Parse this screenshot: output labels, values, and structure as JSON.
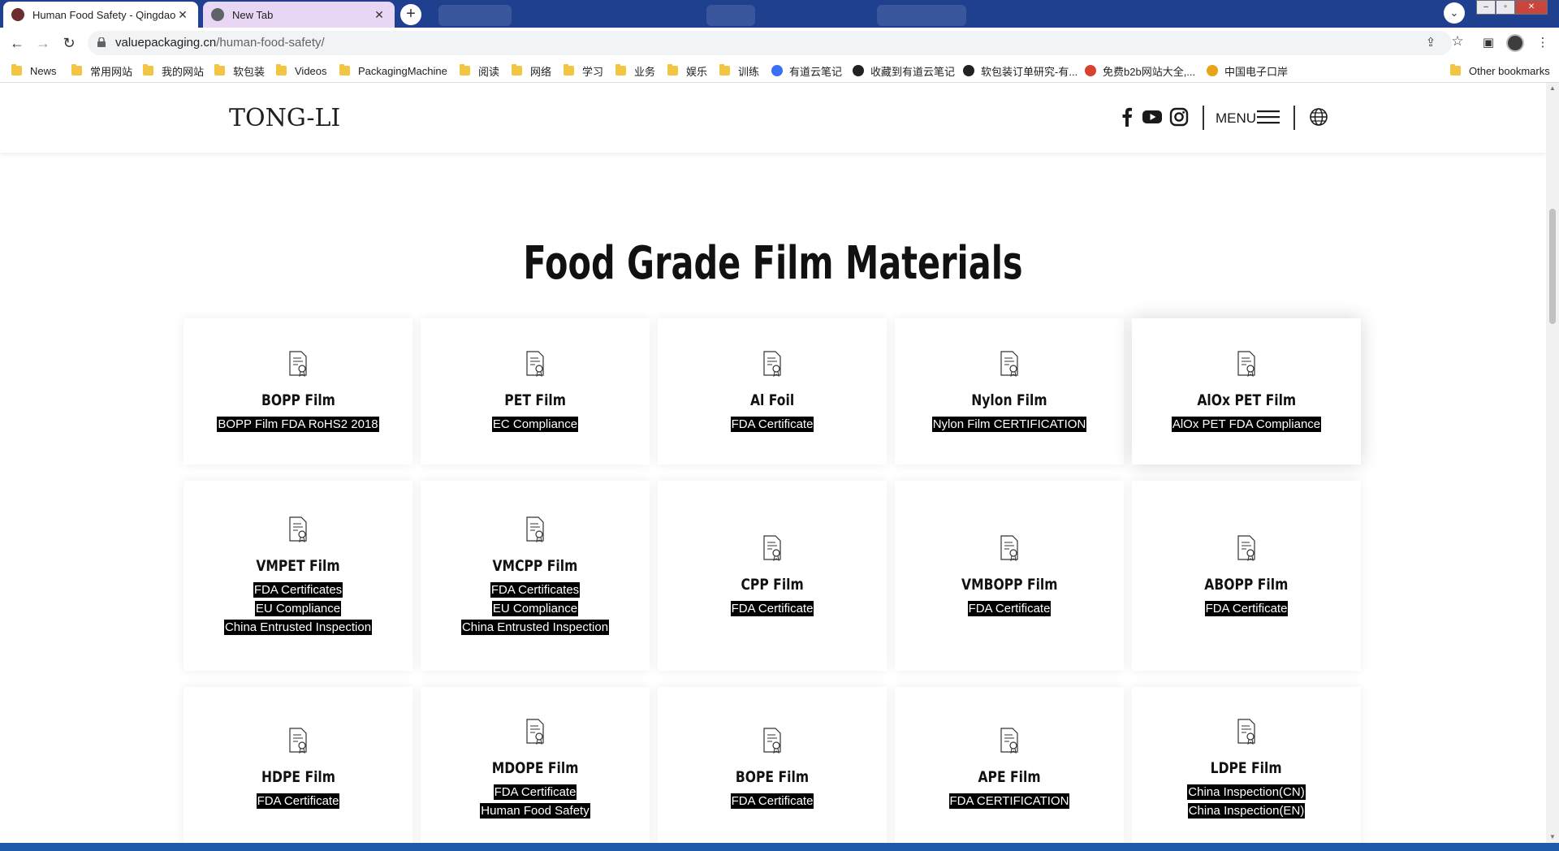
{
  "browser": {
    "tabs": [
      {
        "title": "Human Food Safety - Qingdao",
        "active": true
      },
      {
        "title": "New Tab",
        "active": false
      }
    ],
    "url_host": "valuepackaging.cn",
    "url_path": "/human-food-safety/",
    "bookmarks": [
      {
        "label": "News",
        "type": "folder"
      },
      {
        "label": "常用网站",
        "type": "folder"
      },
      {
        "label": "我的网站",
        "type": "folder"
      },
      {
        "label": "软包装",
        "type": "folder"
      },
      {
        "label": "Videos",
        "type": "folder"
      },
      {
        "label": "PackagingMachine",
        "type": "folder"
      },
      {
        "label": "阅读",
        "type": "folder"
      },
      {
        "label": "网络",
        "type": "folder"
      },
      {
        "label": "学习",
        "type": "folder"
      },
      {
        "label": "业务",
        "type": "folder"
      },
      {
        "label": "娱乐",
        "type": "folder"
      },
      {
        "label": "训练",
        "type": "folder"
      },
      {
        "label": "有道云笔记",
        "type": "link",
        "color": "#3b6ff5"
      },
      {
        "label": "收藏到有道云笔记",
        "type": "link",
        "color": "#222222"
      },
      {
        "label": "软包装订单研究-有...",
        "type": "link",
        "color": "#222222"
      },
      {
        "label": "免费b2b网站大全,...",
        "type": "link",
        "color": "#d9412f"
      },
      {
        "label": "中国电子口岸",
        "type": "link",
        "color": "#e8a21c"
      }
    ],
    "other_bookmarks": "Other bookmarks"
  },
  "site": {
    "logo": "TONG-LI",
    "menu_label": "MENU",
    "section_title": "Food Grade Film Materials",
    "cards": [
      {
        "name": "BOPP Film",
        "tags": [
          "BOPP Film FDA RoHS2 2018"
        ]
      },
      {
        "name": "PET Film",
        "tags": [
          "EC Compliance"
        ]
      },
      {
        "name": "Al Foil",
        "tags": [
          "FDA Certificate"
        ]
      },
      {
        "name": "Nylon Film",
        "tags": [
          "Nylon Film CERTIFICATION"
        ]
      },
      {
        "name": "AlOx PET Film",
        "tags": [
          "AlOx PET FDA Compliance"
        ]
      },
      {
        "name": "VMPET Film",
        "tags": [
          "FDA Certificates",
          "EU Compliance",
          "China Entrusted Inspection"
        ]
      },
      {
        "name": "VMCPP Film",
        "tags": [
          "FDA Certificates",
          "EU Compliance",
          "China Entrusted Inspection"
        ]
      },
      {
        "name": "CPP Film",
        "tags": [
          "FDA Certificate"
        ]
      },
      {
        "name": "VMBOPP Film",
        "tags": [
          "FDA Certificate"
        ]
      },
      {
        "name": "ABOPP Film",
        "tags": [
          "FDA Certificate"
        ]
      },
      {
        "name": "HDPE Film",
        "tags": [
          "FDA Certificate"
        ]
      },
      {
        "name": "MDOPE Film",
        "tags": [
          "FDA Certificate",
          "Human Food Safety"
        ]
      },
      {
        "name": "BOPE Film",
        "tags": [
          "FDA Certificate"
        ]
      },
      {
        "name": "APE Film",
        "tags": [
          "FDA CERTIFICATION"
        ]
      },
      {
        "name": "LDPE Film",
        "tags": [
          "China Inspection(CN)",
          "China Inspection(EN)"
        ]
      }
    ]
  }
}
